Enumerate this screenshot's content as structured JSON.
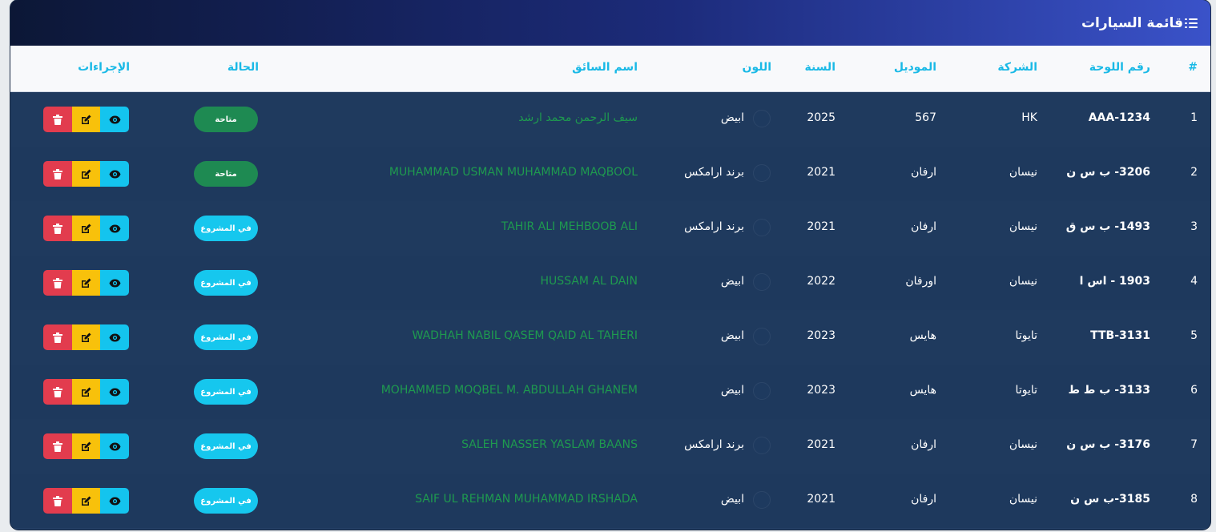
{
  "header": {
    "title": "قائمة السيارات",
    "icon": "list-icon"
  },
  "columns": {
    "index": "#",
    "plate": "رقم اللوحة",
    "company": "الشركة",
    "model": "الموديل",
    "year": "السنة",
    "color": "اللون",
    "driver": "اسم السائق",
    "status": "الحالة",
    "actions": "الإجراءات"
  },
  "colors": {
    "available": "#1e8a52",
    "in_project": "#16c7ee",
    "delete": "#e23c4e",
    "edit": "#f8c10b",
    "view": "#14c4ee",
    "driver_text": "#1e9a4f",
    "header_text": "#19b9e6"
  },
  "rows": [
    {
      "index": "1",
      "plate": "AAA-1234",
      "company": "HK",
      "model": "567",
      "year": "2025",
      "color": "ابيض",
      "driver": "سيف الرحمن محمد ارشد",
      "status": "متاحة",
      "status_type": "available"
    },
    {
      "index": "2",
      "plate": "3206- ب س ن",
      "company": "نيسان",
      "model": "ارفان",
      "year": "2021",
      "color": "برند ارامكس",
      "driver": "MUHAMMAD USMAN MUHAMMAD MAQBOOL",
      "status": "متاحة",
      "status_type": "available"
    },
    {
      "index": "3",
      "plate": "1493- ب س ق",
      "company": "نيسان",
      "model": "ارفان",
      "year": "2021",
      "color": "برند ارامكس",
      "driver": "TAHIR ALI MEHBOOB ALI",
      "status": "في المشروع",
      "status_type": "in_project"
    },
    {
      "index": "4",
      "plate": "1903 - اس ا",
      "company": "نيسان",
      "model": "اورفان",
      "year": "2022",
      "color": "ابيض",
      "driver": "HUSSAM AL DAIN",
      "status": "في المشروع",
      "status_type": "in_project"
    },
    {
      "index": "5",
      "plate": "TTB-3131",
      "company": "تايوتا",
      "model": "هايس",
      "year": "2023",
      "color": "ابيض",
      "driver": "WADHAH NABIL QASEM QAID AL TAHERI",
      "status": "في المشروع",
      "status_type": "in_project"
    },
    {
      "index": "6",
      "plate": "3133- ب ط ط",
      "company": "تايوتا",
      "model": "هايس",
      "year": "2023",
      "color": "ابيض",
      "driver": "MOHAMMED MOQBEL M. ABDULLAH GHANEM",
      "status": "في المشروع",
      "status_type": "in_project"
    },
    {
      "index": "7",
      "plate": "3176- ب س ن",
      "company": "نيسان",
      "model": "ارفان",
      "year": "2021",
      "color": "برند ارامكس",
      "driver": "SALEH NASSER YASLAM BAANS",
      "status": "في المشروع",
      "status_type": "in_project"
    },
    {
      "index": "8",
      "plate": "3185-ب س ن",
      "company": "نيسان",
      "model": "ارفان",
      "year": "2021",
      "color": "ابيض",
      "driver": "SAIF UL REHMAN MUHAMMAD IRSHADA",
      "status": "في المشروع",
      "status_type": "in_project"
    }
  ]
}
